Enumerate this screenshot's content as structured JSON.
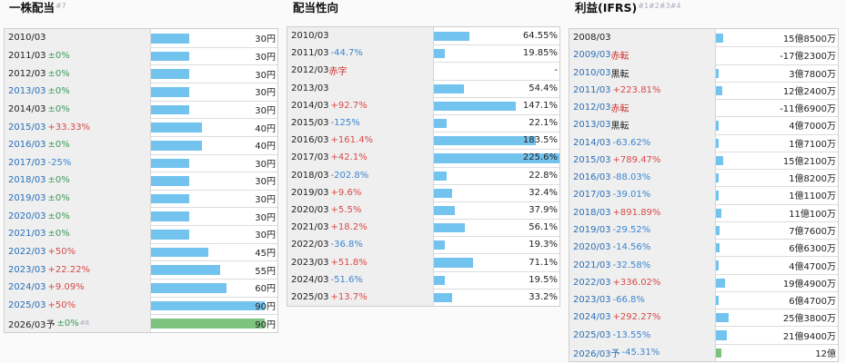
{
  "panels": [
    {
      "title": "一株配当",
      "title_note": "#7",
      "rows": [
        {
          "period": "2010/03",
          "link": false,
          "change": "",
          "dir": "",
          "note": "",
          "value": "30円",
          "bar": 30
        },
        {
          "period": "2011/03",
          "link": false,
          "change": "±0%",
          "dir": "flat",
          "note": "",
          "value": "30円",
          "bar": 30
        },
        {
          "period": "2012/03",
          "link": false,
          "change": "±0%",
          "dir": "flat",
          "note": "",
          "value": "30円",
          "bar": 30
        },
        {
          "period": "2013/03",
          "link": true,
          "change": "±0%",
          "dir": "flat",
          "note": "",
          "value": "30円",
          "bar": 30
        },
        {
          "period": "2014/03",
          "link": false,
          "change": "±0%",
          "dir": "flat",
          "note": "",
          "value": "30円",
          "bar": 30
        },
        {
          "period": "2015/03",
          "link": true,
          "change": "+33.33%",
          "dir": "up",
          "note": "",
          "value": "40円",
          "bar": 40
        },
        {
          "period": "2016/03",
          "link": true,
          "change": "±0%",
          "dir": "flat",
          "note": "",
          "value": "40円",
          "bar": 40
        },
        {
          "period": "2017/03",
          "link": true,
          "change": "-25%",
          "dir": "down",
          "note": "",
          "value": "30円",
          "bar": 30
        },
        {
          "period": "2018/03",
          "link": true,
          "change": "±0%",
          "dir": "flat",
          "note": "",
          "value": "30円",
          "bar": 30
        },
        {
          "period": "2019/03",
          "link": true,
          "change": "±0%",
          "dir": "flat",
          "note": "",
          "value": "30円",
          "bar": 30
        },
        {
          "period": "2020/03",
          "link": true,
          "change": "±0%",
          "dir": "flat",
          "note": "",
          "value": "30円",
          "bar": 30
        },
        {
          "period": "2021/03",
          "link": true,
          "change": "±0%",
          "dir": "flat",
          "note": "",
          "value": "30円",
          "bar": 30
        },
        {
          "period": "2022/03",
          "link": true,
          "change": "+50%",
          "dir": "up",
          "note": "",
          "value": "45円",
          "bar": 45
        },
        {
          "period": "2023/03",
          "link": true,
          "change": "+22.22%",
          "dir": "up",
          "note": "",
          "value": "55円",
          "bar": 55
        },
        {
          "period": "2024/03",
          "link": true,
          "change": "+9.09%",
          "dir": "up",
          "note": "",
          "value": "60円",
          "bar": 60
        },
        {
          "period": "2025/03",
          "link": true,
          "change": "+50%",
          "dir": "up",
          "note": "",
          "value": "90円",
          "bar": 90
        },
        {
          "period": "2026/03予",
          "link": false,
          "change": "±0%",
          "dir": "flat",
          "note": "",
          "sup": "#8",
          "value": "90円",
          "bar": 90,
          "forecast": true
        }
      ]
    },
    {
      "title": "配当性向",
      "title_note": "",
      "rows": [
        {
          "period": "2010/03",
          "link": false,
          "change": "",
          "dir": "",
          "note": "",
          "value": "64.55%",
          "bar": 64.55
        },
        {
          "period": "2011/03",
          "link": false,
          "change": "-44.7%",
          "dir": "down",
          "note": "",
          "value": "19.85%",
          "bar": 19.85
        },
        {
          "period": "2012/03",
          "link": false,
          "change": "",
          "dir": "",
          "note": "赤字",
          "value": "-",
          "bar": 0
        },
        {
          "period": "2013/03",
          "link": false,
          "change": "",
          "dir": "",
          "note": "",
          "value": "54.4%",
          "bar": 54.4
        },
        {
          "period": "2014/03",
          "link": false,
          "change": "+92.7%",
          "dir": "up",
          "note": "",
          "value": "147.1%",
          "bar": 147.1
        },
        {
          "period": "2015/03",
          "link": false,
          "change": "-125%",
          "dir": "down",
          "note": "",
          "value": "22.1%",
          "bar": 22.1
        },
        {
          "period": "2016/03",
          "link": false,
          "change": "+161.4%",
          "dir": "up",
          "note": "",
          "value": "183.5%",
          "bar": 183.5
        },
        {
          "period": "2017/03",
          "link": false,
          "change": "+42.1%",
          "dir": "up",
          "note": "",
          "value": "225.6%",
          "bar": 225.6
        },
        {
          "period": "2018/03",
          "link": false,
          "change": "-202.8%",
          "dir": "down",
          "note": "",
          "value": "22.8%",
          "bar": 22.8
        },
        {
          "period": "2019/03",
          "link": false,
          "change": "+9.6%",
          "dir": "up",
          "note": "",
          "value": "32.4%",
          "bar": 32.4
        },
        {
          "period": "2020/03",
          "link": false,
          "change": "+5.5%",
          "dir": "up",
          "note": "",
          "value": "37.9%",
          "bar": 37.9
        },
        {
          "period": "2021/03",
          "link": false,
          "change": "+18.2%",
          "dir": "up",
          "note": "",
          "value": "56.1%",
          "bar": 56.1
        },
        {
          "period": "2022/03",
          "link": false,
          "change": "-36.8%",
          "dir": "down",
          "note": "",
          "value": "19.3%",
          "bar": 19.3
        },
        {
          "period": "2023/03",
          "link": false,
          "change": "+51.8%",
          "dir": "up",
          "note": "",
          "value": "71.1%",
          "bar": 71.1
        },
        {
          "period": "2024/03",
          "link": false,
          "change": "-51.6%",
          "dir": "down",
          "note": "",
          "value": "19.5%",
          "bar": 19.5
        },
        {
          "period": "2025/03",
          "link": false,
          "change": "+13.7%",
          "dir": "up",
          "note": "",
          "value": "33.2%",
          "bar": 33.2
        }
      ]
    },
    {
      "title": "利益(IFRS)",
      "title_note": "#1#2#3#4",
      "rows": [
        {
          "period": "2008/03",
          "link": false,
          "change": "",
          "dir": "",
          "note": "",
          "value": "15億8500万",
          "bar": 1585
        },
        {
          "period": "2009/03",
          "link": true,
          "change": "",
          "dir": "",
          "note": "赤転",
          "note_style": "red",
          "value": "-17億2300万",
          "bar": 0
        },
        {
          "period": "2010/03",
          "link": true,
          "change": "",
          "dir": "",
          "note": "黒転",
          "note_style": "dark",
          "value": "3億7800万",
          "bar": 378
        },
        {
          "period": "2011/03",
          "link": true,
          "change": "+223.81%",
          "dir": "up",
          "note": "",
          "value": "12億2400万",
          "bar": 1224
        },
        {
          "period": "2012/03",
          "link": true,
          "change": "",
          "dir": "",
          "note": "赤転",
          "note_style": "red",
          "value": "-11億6900万",
          "bar": 0
        },
        {
          "period": "2013/03",
          "link": true,
          "change": "",
          "dir": "",
          "note": "黒転",
          "note_style": "dark",
          "value": "4億7000万",
          "bar": 470
        },
        {
          "period": "2014/03",
          "link": true,
          "change": "-63.62%",
          "dir": "down",
          "note": "",
          "value": "1億7100万",
          "bar": 171
        },
        {
          "period": "2015/03",
          "link": true,
          "change": "+789.47%",
          "dir": "up",
          "note": "",
          "value": "15億2100万",
          "bar": 1521
        },
        {
          "period": "2016/03",
          "link": true,
          "change": "-88.03%",
          "dir": "down",
          "note": "",
          "value": "1億8200万",
          "bar": 182
        },
        {
          "period": "2017/03",
          "link": true,
          "change": "-39.01%",
          "dir": "down",
          "note": "",
          "value": "1億1100万",
          "bar": 111
        },
        {
          "period": "2018/03",
          "link": true,
          "change": "+891.89%",
          "dir": "up",
          "note": "",
          "value": "11億100万",
          "bar": 1101
        },
        {
          "period": "2019/03",
          "link": true,
          "change": "-29.52%",
          "dir": "down",
          "note": "",
          "value": "7億7600万",
          "bar": 776
        },
        {
          "period": "2020/03",
          "link": true,
          "change": "-14.56%",
          "dir": "down",
          "note": "",
          "value": "6億6300万",
          "bar": 663
        },
        {
          "period": "2021/03",
          "link": true,
          "change": "-32.58%",
          "dir": "down",
          "note": "",
          "value": "4億4700万",
          "bar": 447
        },
        {
          "period": "2022/03",
          "link": true,
          "change": "+336.02%",
          "dir": "up",
          "note": "",
          "value": "19億4900万",
          "bar": 1949
        },
        {
          "period": "2023/03",
          "link": true,
          "change": "-66.8%",
          "dir": "down",
          "note": "",
          "value": "6億4700万",
          "bar": 647
        },
        {
          "period": "2024/03",
          "link": true,
          "change": "+292.27%",
          "dir": "up",
          "note": "",
          "value": "25億3800万",
          "bar": 2538
        },
        {
          "period": "2025/03",
          "link": true,
          "change": "-13.55%",
          "dir": "down",
          "note": "",
          "value": "21億9400万",
          "bar": 2194
        },
        {
          "period": "2026/03予",
          "link": true,
          "change": "-45.31%",
          "dir": "down",
          "note": "",
          "value": "12億",
          "bar": 1200,
          "forecast": true
        }
      ]
    }
  ],
  "colors": {
    "bar": "#72c3ee",
    "bar_forecast": "#7dc37f",
    "up": "#d84a4a",
    "down": "#3c86d0",
    "flat": "#3a9a5a",
    "link": "#2a6fb7"
  }
}
